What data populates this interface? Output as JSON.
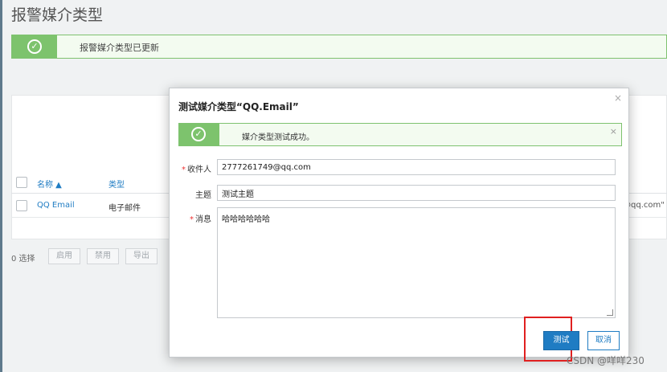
{
  "page": {
    "title": "报警媒介类型",
    "success_message": "报警媒介类型已更新"
  },
  "table": {
    "columns": [
      "名称 ▲",
      "类型"
    ],
    "rows": [
      {
        "name": "QQ Email",
        "type": "电子邮件",
        "sendto_fragment": "@qq.com\""
      }
    ]
  },
  "bulk_actions": {
    "selected_count": "0 选择",
    "enable_label": "启用",
    "disable_label": "禁用",
    "export_label": "导出"
  },
  "modal": {
    "title": "测试媒介类型“QQ.Email”",
    "close_symbol": "×",
    "success_message": "媒介类型测试成功。",
    "form": {
      "recipient_label": "收件人",
      "recipient_value": "2777261749@qq.com",
      "subject_label": "主题",
      "subject_value": "测试主题",
      "message_label": "消息",
      "message_value": "哈哈哈哈哈哈"
    },
    "test_button": "测试",
    "cancel_button": "取消"
  },
  "watermark": "CSDN @咩咩230",
  "colors": {
    "success_green": "#7dc36d",
    "primary_blue": "#1f7cc3",
    "highlight_red": "#e02020"
  }
}
